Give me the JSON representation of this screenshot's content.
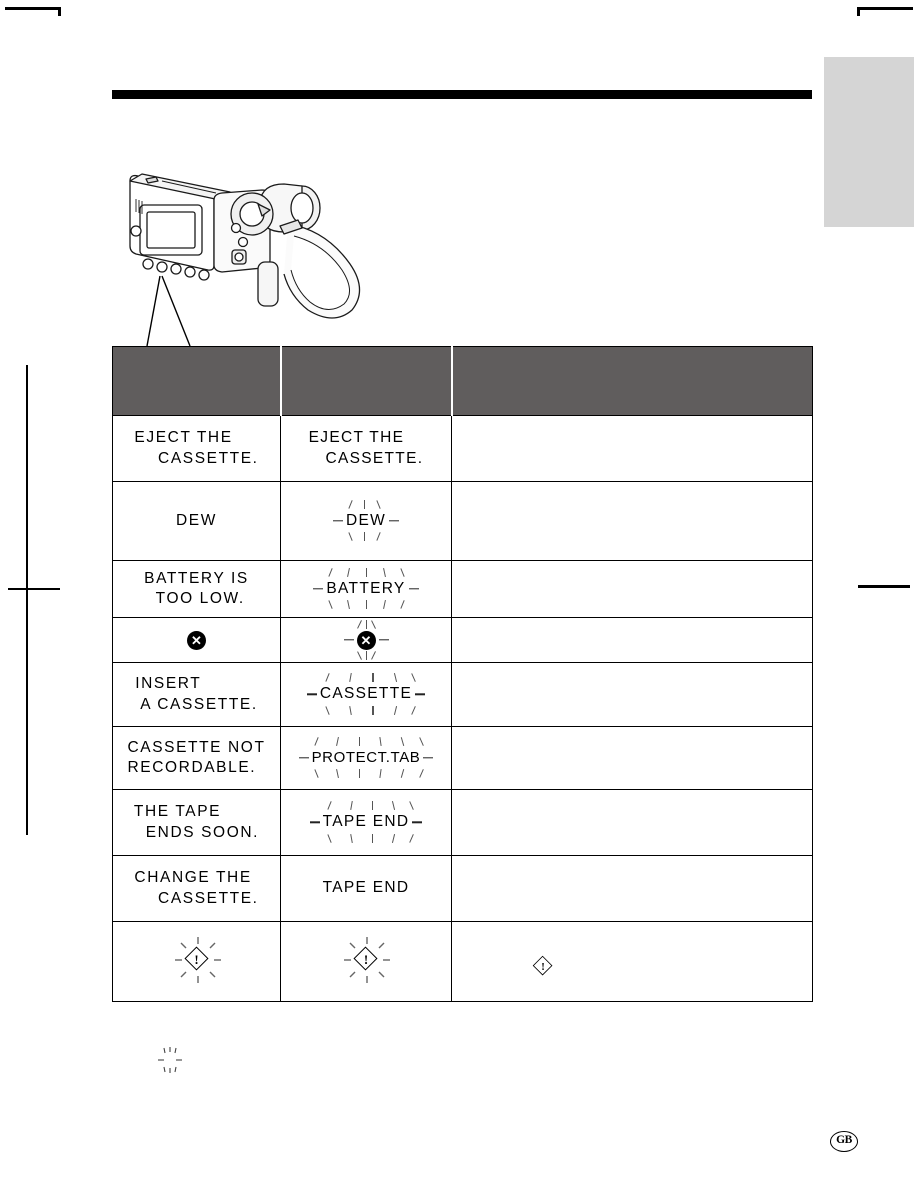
{
  "page": {
    "marker": "GB",
    "side_tab_color": "#d5d5d5",
    "header_band_color": "#605d5d",
    "rule_color": "#000000"
  },
  "illustration": {
    "name": "camcorder-rear-view",
    "callout_target": "lcd-monitor",
    "leader_line_count": 2
  },
  "table": {
    "headers": [
      "",
      "",
      ""
    ],
    "rows": [
      {
        "lcd": "EJECT THE\n    CASSETTE.",
        "lcd_blinking": false,
        "viewfinder": "EJECT THE\n   CASSETTE.",
        "viewfinder_blinking": false,
        "meaning": "",
        "type": "text"
      },
      {
        "lcd": "DEW",
        "lcd_blinking": false,
        "viewfinder": "DEW",
        "viewfinder_blinking": true,
        "meaning": "",
        "type": "text"
      },
      {
        "lcd": "BATTERY IS\n  TOO LOW.",
        "lcd_blinking": false,
        "viewfinder": "BATTERY",
        "viewfinder_blinking": true,
        "meaning": "",
        "type": "text"
      },
      {
        "lcd": "circled-x-symbol",
        "lcd_blinking": false,
        "viewfinder": "circled-x-symbol",
        "viewfinder_blinking": true,
        "meaning": "",
        "type": "symbol-x"
      },
      {
        "lcd": "INSERT\n A CASSETTE.",
        "lcd_blinking": false,
        "viewfinder": "CASSETTE",
        "viewfinder_blinking": true,
        "meaning": "",
        "type": "text"
      },
      {
        "lcd": "CASSETTE NOT\nRECORDABLE.",
        "lcd_blinking": false,
        "viewfinder": "PROTECT.TAB",
        "viewfinder_blinking": true,
        "meaning": "",
        "type": "text"
      },
      {
        "lcd": "THE TAPE\n  ENDS SOON.",
        "lcd_blinking": false,
        "viewfinder": "TAPE END",
        "viewfinder_blinking": true,
        "meaning": "",
        "type": "text"
      },
      {
        "lcd": "CHANGE THE\n    CASSETTE.",
        "lcd_blinking": false,
        "viewfinder": "TAPE END",
        "viewfinder_blinking": false,
        "meaning": "",
        "type": "text"
      },
      {
        "lcd": "warning-diamond-symbol",
        "lcd_blinking": true,
        "viewfinder": "warning-diamond-symbol",
        "viewfinder_blinking": true,
        "meaning": "warning-diamond-symbol",
        "type": "symbol-warning"
      }
    ]
  },
  "footnote": {
    "marker": "blink-rays-symbol",
    "text": ""
  }
}
